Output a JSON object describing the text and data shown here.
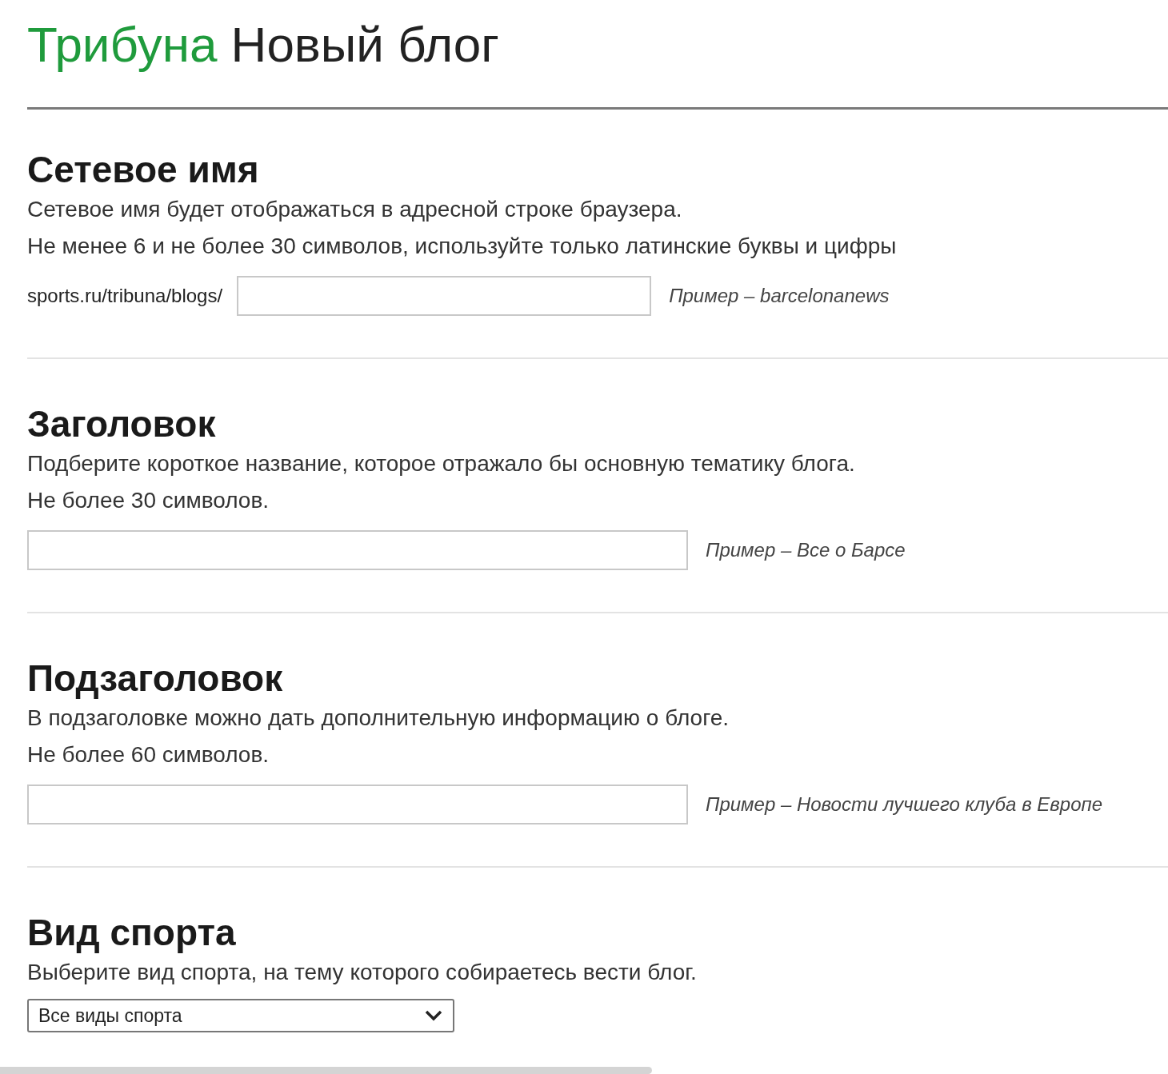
{
  "header": {
    "brand": "Трибуна",
    "title": "Новый блог"
  },
  "sections": [
    {
      "kind": "prefixed_input",
      "heading": "Сетевое имя",
      "description": [
        "Сетевое имя будет отображаться в адресной строке браузера.",
        "Не менее 6 и не более 30 символов, используйте только латинские буквы и цифры"
      ],
      "prefix": "sports.ru/tribuna/blogs/",
      "example": "Пример – barcelonanews"
    },
    {
      "kind": "input",
      "heading": "Заголовок",
      "description": [
        "Подберите короткое название, которое отражало бы основную тематику блога.",
        "Не более 30 символов."
      ],
      "example": "Пример – Все о Барсе"
    },
    {
      "kind": "input",
      "heading": "Подзаголовок",
      "description": [
        "В подзаголовке можно дать дополнительную информацию о блоге.",
        "Не более 60 символов."
      ],
      "example": "Пример – Новости лучшего клуба в Европе"
    },
    {
      "kind": "select",
      "heading": "Вид спорта",
      "description": [
        "Выберите вид спорта, на тему которого собираетесь вести блог."
      ],
      "value": "Все виды спорта"
    }
  ]
}
